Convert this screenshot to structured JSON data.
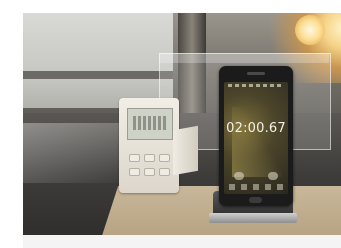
{
  "photo": {
    "description_label": "",
    "phone": {
      "timer_display": "02:00.67"
    },
    "colors": {
      "scene_light": "#f6d489",
      "table_dark": "#3f3d3b",
      "cardboard": "#c8b79a",
      "phone_body": "#1b1b1c",
      "timer_body": "#f2eee6"
    }
  }
}
